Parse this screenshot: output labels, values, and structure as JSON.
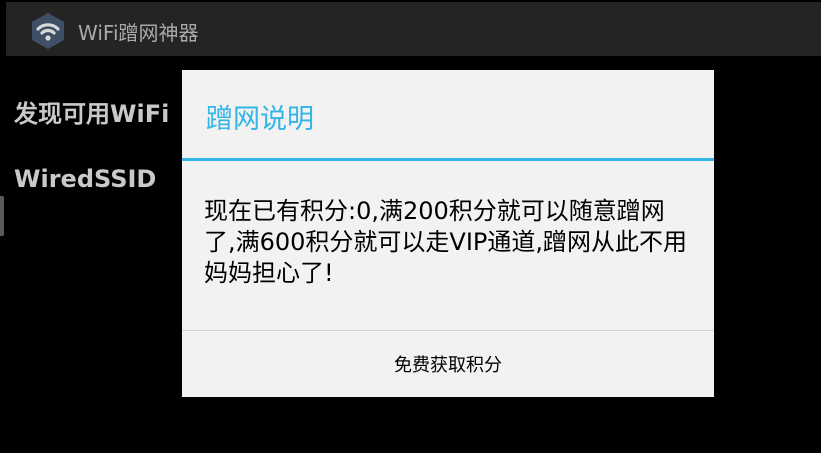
{
  "action_bar": {
    "title": "WiFi蹭网神器",
    "icon": "wifi-icon"
  },
  "background": {
    "heading": "发现可用WiFi",
    "ssid": "WiredSSID"
  },
  "dialog": {
    "title": "蹭网说明",
    "message": "现在已有积分:0,满200积分就可以随意蹭网了,满600积分就可以走VIP通道,蹭网从此不用妈妈担心了!",
    "button_label": "免费获取积分"
  },
  "colors": {
    "accent": "#33b5e5",
    "dialog_bg": "#f2f2f2",
    "screen_bg": "#000000"
  }
}
